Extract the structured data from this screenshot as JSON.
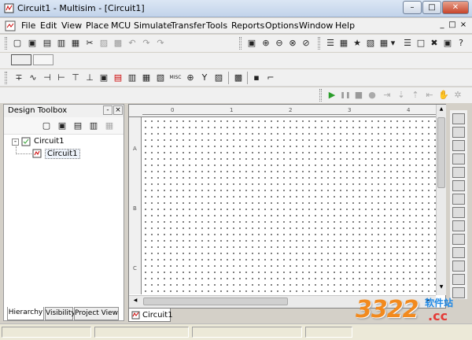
{
  "window": {
    "title": "Circuit1 - Multisim - [Circuit1]",
    "min_label": "–",
    "max_label": "□",
    "close_label": "✕"
  },
  "menu": {
    "items": [
      "File",
      "Edit",
      "View",
      "Place",
      "MCU",
      "Simulate",
      "Transfer",
      "Tools",
      "Reports",
      "Options",
      "Window",
      "Help"
    ],
    "mdi": [
      "_",
      "□",
      "×"
    ]
  },
  "toolbars": {
    "standard": [
      "▢",
      "▣",
      "▤",
      "▥",
      "▦",
      "✂",
      "▨",
      "▩",
      "↶",
      "↷"
    ],
    "view": [
      "▣",
      "⊕",
      "⊖",
      "⊗",
      "⊘"
    ],
    "main": [
      "☰",
      "▦",
      "★",
      "▧",
      "▾",
      "▦",
      "☰",
      "□",
      "✖",
      "▣"
    ],
    "components": [
      "∓",
      "∿",
      "⊣",
      "⊢",
      "⊤",
      "⊥",
      "▣",
      "▤",
      "▥",
      "▦",
      "MISC",
      "▧",
      "Y",
      "⊕",
      "▨",
      "▩",
      "▪"
    ],
    "simulate": {
      "run": "▶",
      "pause": "❚❚",
      "stop": "■"
    }
  },
  "design_toolbox": {
    "title": "Design Toolbox",
    "tree": [
      {
        "label": "Circuit1",
        "level": 0
      },
      {
        "label": "Circuit1",
        "level": 1
      }
    ],
    "tabs": [
      "Hierarchy",
      "Visibility",
      "Project View"
    ]
  },
  "ruler": {
    "top_labels": [
      "0",
      "1",
      "2",
      "3",
      "4"
    ],
    "left_labels": [
      "A",
      "B",
      "C"
    ]
  },
  "document_tab": "Circuit1",
  "watermark": {
    "number": "3322",
    "cn_text": "软件站",
    "domain": ".cc"
  },
  "colors": {
    "accent_run": "#2a9d2a",
    "watermark_orange": "#f28a1e"
  }
}
